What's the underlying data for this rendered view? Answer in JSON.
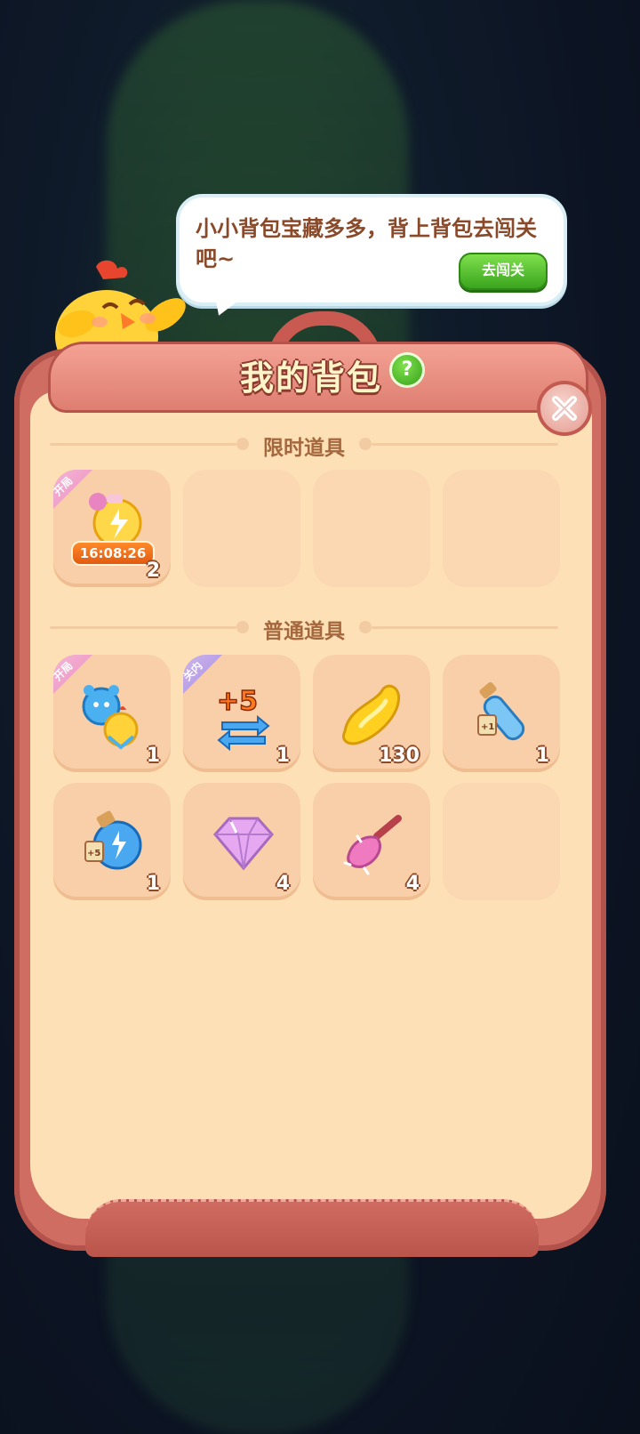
{
  "bubble": {
    "text": "小小背包宝藏多多，背上背包去闯关吧~",
    "button_label": "去闯关"
  },
  "panel": {
    "title": "我的背包",
    "help_label": "?",
    "close_label": "✕"
  },
  "sections": {
    "limited": {
      "title": "限时道具"
    },
    "normal": {
      "title": "普通道具"
    }
  },
  "limited_items": [
    {
      "icon": "lightning-potion-icon",
      "ribbon": "开局",
      "timer": "16:08:26",
      "count": "2"
    }
  ],
  "normal_items": [
    {
      "icon": "bear-chick-swap-icon",
      "ribbon": "开局",
      "count": "1"
    },
    {
      "icon": "plus-five-moves-icon",
      "ribbon": "关内",
      "count": "1"
    },
    {
      "icon": "golden-bean-icon",
      "count": "130"
    },
    {
      "icon": "tube-plus-one-icon",
      "count": "1"
    },
    {
      "icon": "bottle-plus-five-icon",
      "count": "1"
    },
    {
      "icon": "diamond-icon",
      "count": "4"
    },
    {
      "icon": "magic-broom-icon",
      "count": "4"
    }
  ],
  "tags": {
    "plus1": "+1",
    "plus5": "+5",
    "big_plus5": "+5"
  },
  "colors": {
    "accent": "#cf6d62",
    "inner": "#fde0b6",
    "button_green": "#3aa51e"
  }
}
